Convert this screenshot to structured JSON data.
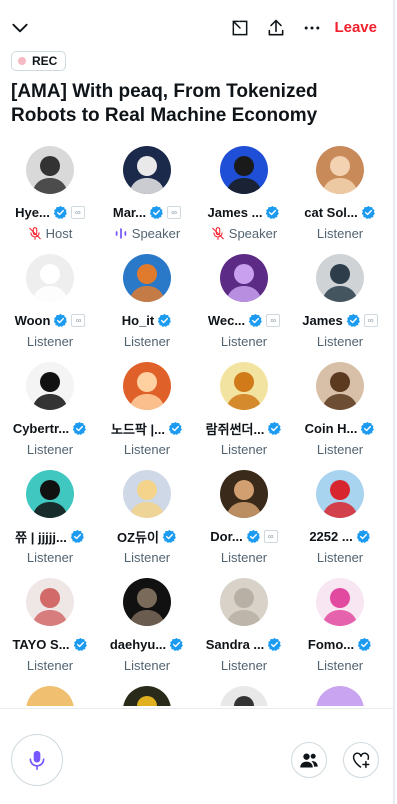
{
  "header": {
    "leave_label": "Leave",
    "rec_label": "REC"
  },
  "space": {
    "title": "[AMA] With peaq, From Tokenized Robots to Real Machine Economy"
  },
  "participants": [
    {
      "name": "Hye...",
      "role": "Host",
      "role_icon": "mic-off-icon",
      "verified": true,
      "extra_badge": true,
      "avatar_color": "#d9d9d9",
      "avatar_fg": "#333333"
    },
    {
      "name": "Mar...",
      "role": "Speaker",
      "role_icon": "speaking-bars-icon",
      "verified": true,
      "extra_badge": true,
      "avatar_color": "#1b2a4a",
      "avatar_fg": "#e9e9e9"
    },
    {
      "name": "James ...",
      "role": "Speaker",
      "role_icon": "mic-off-icon",
      "verified": true,
      "extra_badge": false,
      "avatar_color": "#1f4fd6",
      "avatar_fg": "#1a1a1a"
    },
    {
      "name": "cat Sol...",
      "role": "Listener",
      "role_icon": "",
      "verified": true,
      "extra_badge": false,
      "avatar_color": "#c98a5a",
      "avatar_fg": "#f2d2b0"
    },
    {
      "name": "Woon",
      "role": "Listener",
      "role_icon": "",
      "verified": true,
      "extra_badge": true,
      "avatar_color": "#eeeeee",
      "avatar_fg": "#ffffff"
    },
    {
      "name": "Ho_it",
      "role": "Listener",
      "role_icon": "",
      "verified": true,
      "extra_badge": false,
      "avatar_color": "#2a78c8",
      "avatar_fg": "#e07b2e"
    },
    {
      "name": "Wec...",
      "role": "Listener",
      "role_icon": "",
      "verified": true,
      "extra_badge": true,
      "avatar_color": "#5b2b86",
      "avatar_fg": "#c9a0f0"
    },
    {
      "name": "James",
      "role": "Listener",
      "role_icon": "",
      "verified": true,
      "extra_badge": true,
      "avatar_color": "#cfd3d6",
      "avatar_fg": "#2d3e4a"
    },
    {
      "name": "Cybertr...",
      "role": "Listener",
      "role_icon": "",
      "verified": true,
      "extra_badge": false,
      "avatar_color": "#f4f4f4",
      "avatar_fg": "#111111"
    },
    {
      "name": "노드팍 |...",
      "role": "Listener",
      "role_icon": "",
      "verified": true,
      "extra_badge": false,
      "avatar_color": "#e0602a",
      "avatar_fg": "#ffd0a0"
    },
    {
      "name": "람쥐썬더...",
      "role": "Listener",
      "role_icon": "",
      "verified": true,
      "extra_badge": false,
      "avatar_color": "#f2e4a0",
      "avatar_fg": "#d07a1a"
    },
    {
      "name": "Coin H...",
      "role": "Listener",
      "role_icon": "",
      "verified": true,
      "extra_badge": false,
      "avatar_color": "#d8c0a8",
      "avatar_fg": "#5b3a20"
    },
    {
      "name": "쮸 | jjjjj...",
      "role": "Listener",
      "role_icon": "",
      "verified": true,
      "extra_badge": false,
      "avatar_color": "#3fc7c0",
      "avatar_fg": "#111111"
    },
    {
      "name": "OZ듀이",
      "role": "Listener",
      "role_icon": "",
      "verified": true,
      "extra_badge": false,
      "avatar_color": "#cfd8e6",
      "avatar_fg": "#f4d48a"
    },
    {
      "name": "Dor...",
      "role": "Listener",
      "role_icon": "",
      "verified": true,
      "extra_badge": true,
      "avatar_color": "#3a2a1a",
      "avatar_fg": "#d2a070"
    },
    {
      "name": "2252 ...",
      "role": "Listener",
      "role_icon": "",
      "verified": true,
      "extra_badge": false,
      "avatar_color": "#a8d4f0",
      "avatar_fg": "#d8262e"
    },
    {
      "name": "TAYO S...",
      "role": "Listener",
      "role_icon": "",
      "verified": true,
      "extra_badge": false,
      "avatar_color": "#efe6e6",
      "avatar_fg": "#d26a6a"
    },
    {
      "name": "daehyu...",
      "role": "Listener",
      "role_icon": "",
      "verified": true,
      "extra_badge": false,
      "avatar_color": "#111111",
      "avatar_fg": "#7a6a5a"
    },
    {
      "name": "Sandra ...",
      "role": "Listener",
      "role_icon": "",
      "verified": true,
      "extra_badge": false,
      "avatar_color": "#d8d2c8",
      "avatar_fg": "#b8b0a4"
    },
    {
      "name": "Fomo...",
      "role": "Listener",
      "role_icon": "",
      "verified": true,
      "extra_badge": false,
      "avatar_color": "#f8e6f2",
      "avatar_fg": "#e24aa0"
    },
    {
      "name": "",
      "role": "",
      "role_icon": "",
      "verified": false,
      "extra_badge": false,
      "avatar_color": "#f0c070",
      "avatar_fg": "#f0c070"
    },
    {
      "name": "",
      "role": "",
      "role_icon": "",
      "verified": false,
      "extra_badge": false,
      "avatar_color": "#2a2a1a",
      "avatar_fg": "#e0b020"
    },
    {
      "name": "",
      "role": "",
      "role_icon": "",
      "verified": false,
      "extra_badge": false,
      "avatar_color": "#e8e8e8",
      "avatar_fg": "#333333"
    },
    {
      "name": "",
      "role": "",
      "role_icon": "",
      "verified": false,
      "extra_badge": false,
      "avatar_color": "#c9a4f0",
      "avatar_fg": "#c9a4f0"
    }
  ],
  "colors": {
    "accent": "#1d9bf0",
    "leave": "#f4212e",
    "mic": "#7856ff",
    "muted": "#f4212e",
    "text_secondary": "#536471"
  }
}
